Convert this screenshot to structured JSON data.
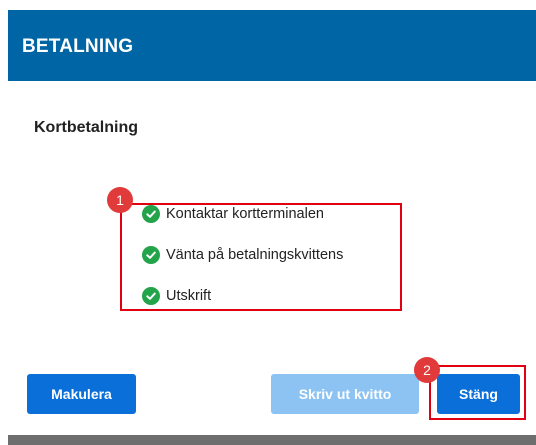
{
  "header": {
    "title": "BETALNING"
  },
  "main": {
    "subtitle": "Kortbetalning"
  },
  "status_list": {
    "items": [
      {
        "label": "Kontaktar kortterminalen",
        "icon": "check-circle-icon",
        "state": "done"
      },
      {
        "label": "Vänta på betalningskvittens",
        "icon": "check-circle-icon",
        "state": "done"
      },
      {
        "label": "Utskrift",
        "icon": "check-circle-icon",
        "state": "done"
      }
    ]
  },
  "markers": {
    "one": "1",
    "two": "2"
  },
  "footer": {
    "cancel_label": "Makulera",
    "print_label": "Skriv ut kvitto",
    "close_label": "Stäng"
  },
  "colors": {
    "header_bg": "#0065a4",
    "primary_button": "#0a6fd9",
    "disabled_button": "#8cc3f2",
    "success_check": "#23a34a",
    "highlight_border": "#e1000f",
    "marker_bg": "#e03a3a"
  }
}
